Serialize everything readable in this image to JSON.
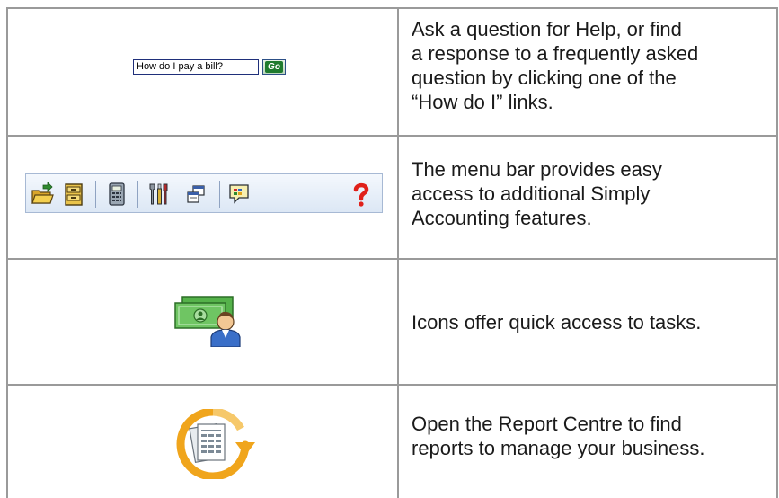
{
  "rows": [
    {
      "description": "Ask a question for Help, or find\na response to a frequently asked\nquestion by clicking one of the\n“How do I” links.",
      "help_input_value": "How do I pay a bill?",
      "go_label": "Go"
    },
    {
      "description": "The menu bar provides easy\naccess to additional Simply\nAccounting features.",
      "menu_icons": [
        "open-folder-icon",
        "file-cabinet-icon",
        "calculator-icon",
        "tools-icon",
        "windows-icon",
        "chat-icon",
        "help-icon"
      ]
    },
    {
      "description": "Icons offer quick access to tasks.",
      "icon": "money-user-icon"
    },
    {
      "description": "Open the Report Centre to find\nreports to manage your business.",
      "icon": "report-centre-icon"
    }
  ],
  "colors": {
    "grid": "#9a9a9a",
    "menubar": "#dce7f5",
    "help_red": "#e0201a",
    "go_green": "#1f7b2e"
  }
}
